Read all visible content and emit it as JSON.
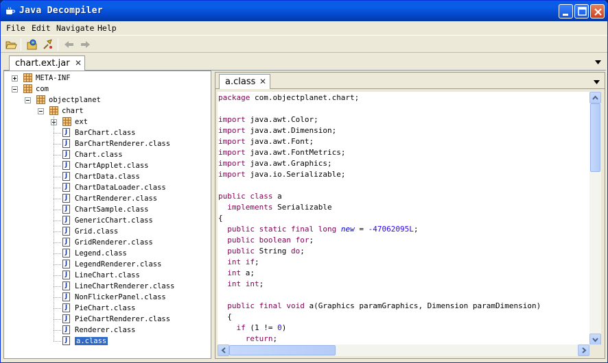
{
  "window": {
    "title": "Java Decompiler"
  },
  "menu": [
    {
      "label": "File"
    },
    {
      "label": "Edit"
    },
    {
      "label": "Navigate"
    },
    {
      "label": "Help"
    }
  ],
  "toolbar": {
    "icons": [
      "open-file-icon",
      "open-type-icon",
      "search-icon",
      "back-arrow-icon",
      "forward-arrow-icon"
    ]
  },
  "left_tab": {
    "label": "chart.ext.jar"
  },
  "right_tab": {
    "label": "a.class"
  },
  "tree": [
    {
      "label": "META-INF",
      "kind": "package",
      "depth": 0,
      "expander": "plus"
    },
    {
      "label": "com",
      "kind": "package",
      "depth": 0,
      "expander": "minus"
    },
    {
      "label": "objectplanet",
      "kind": "package",
      "depth": 1,
      "expander": "minus"
    },
    {
      "label": "chart",
      "kind": "package",
      "depth": 2,
      "expander": "minus"
    },
    {
      "label": "ext",
      "kind": "package",
      "depth": 3,
      "expander": "plus"
    },
    {
      "label": "BarChart.class",
      "kind": "class",
      "depth": 3
    },
    {
      "label": "BarChartRenderer.class",
      "kind": "class",
      "depth": 3
    },
    {
      "label": "Chart.class",
      "kind": "class",
      "depth": 3
    },
    {
      "label": "ChartApplet.class",
      "kind": "class",
      "depth": 3
    },
    {
      "label": "ChartData.class",
      "kind": "class",
      "depth": 3
    },
    {
      "label": "ChartDataLoader.class",
      "kind": "class",
      "depth": 3
    },
    {
      "label": "ChartRenderer.class",
      "kind": "class",
      "depth": 3
    },
    {
      "label": "ChartSample.class",
      "kind": "class",
      "depth": 3
    },
    {
      "label": "GenericChart.class",
      "kind": "class",
      "depth": 3
    },
    {
      "label": "Grid.class",
      "kind": "class",
      "depth": 3
    },
    {
      "label": "GridRenderer.class",
      "kind": "class",
      "depth": 3
    },
    {
      "label": "Legend.class",
      "kind": "class",
      "depth": 3
    },
    {
      "label": "LegendRenderer.class",
      "kind": "class",
      "depth": 3
    },
    {
      "label": "LineChart.class",
      "kind": "class",
      "depth": 3
    },
    {
      "label": "LineChartRenderer.class",
      "kind": "class",
      "depth": 3
    },
    {
      "label": "NonFlickerPanel.class",
      "kind": "class",
      "depth": 3
    },
    {
      "label": "PieChart.class",
      "kind": "class",
      "depth": 3
    },
    {
      "label": "PieChartRenderer.class",
      "kind": "class",
      "depth": 3
    },
    {
      "label": "Renderer.class",
      "kind": "class",
      "depth": 3
    },
    {
      "label": "a.class",
      "kind": "class",
      "depth": 3,
      "selected": true
    }
  ],
  "code": [
    [
      {
        "t": "package",
        "c": "kw"
      },
      {
        "t": " com.objectplanet.chart;"
      }
    ],
    [],
    [
      {
        "t": "import",
        "c": "kw"
      },
      {
        "t": " java.awt.Color;"
      }
    ],
    [
      {
        "t": "import",
        "c": "kw"
      },
      {
        "t": " java.awt.Dimension;"
      }
    ],
    [
      {
        "t": "import",
        "c": "kw"
      },
      {
        "t": " java.awt.Font;"
      }
    ],
    [
      {
        "t": "import",
        "c": "kw"
      },
      {
        "t": " java.awt.FontMetrics;"
      }
    ],
    [
      {
        "t": "import",
        "c": "kw"
      },
      {
        "t": " java.awt.Graphics;"
      }
    ],
    [
      {
        "t": "import",
        "c": "kw"
      },
      {
        "t": " java.io.Serializable;"
      }
    ],
    [],
    [
      {
        "t": "public",
        "c": "kw"
      },
      {
        "t": " "
      },
      {
        "t": "class",
        "c": "kw"
      },
      {
        "t": " a"
      }
    ],
    [
      {
        "t": "  "
      },
      {
        "t": "implements",
        "c": "kw"
      },
      {
        "t": " Serializable"
      }
    ],
    [
      {
        "t": "{"
      }
    ],
    [
      {
        "t": "  "
      },
      {
        "t": "public",
        "c": "kw"
      },
      {
        "t": " "
      },
      {
        "t": "static",
        "c": "kw"
      },
      {
        "t": " "
      },
      {
        "t": "final",
        "c": "kw"
      },
      {
        "t": " "
      },
      {
        "t": "long",
        "c": "kw"
      },
      {
        "t": " "
      },
      {
        "t": "new",
        "c": "fld"
      },
      {
        "t": " = "
      },
      {
        "t": "-47062095L",
        "c": "num"
      },
      {
        "t": ";"
      }
    ],
    [
      {
        "t": "  "
      },
      {
        "t": "public",
        "c": "kw"
      },
      {
        "t": " "
      },
      {
        "t": "boolean",
        "c": "kw"
      },
      {
        "t": " "
      },
      {
        "t": "for",
        "c": "kw"
      },
      {
        "t": ";"
      }
    ],
    [
      {
        "t": "  "
      },
      {
        "t": "public",
        "c": "kw"
      },
      {
        "t": " String "
      },
      {
        "t": "do",
        "c": "kw"
      },
      {
        "t": ";"
      }
    ],
    [
      {
        "t": "  "
      },
      {
        "t": "int",
        "c": "kw"
      },
      {
        "t": " "
      },
      {
        "t": "if",
        "c": "kw"
      },
      {
        "t": ";"
      }
    ],
    [
      {
        "t": "  "
      },
      {
        "t": "int",
        "c": "kw"
      },
      {
        "t": " a;"
      }
    ],
    [
      {
        "t": "  "
      },
      {
        "t": "int",
        "c": "kw"
      },
      {
        "t": " "
      },
      {
        "t": "int",
        "c": "kw"
      },
      {
        "t": ";"
      }
    ],
    [],
    [
      {
        "t": "  "
      },
      {
        "t": "public",
        "c": "kw"
      },
      {
        "t": " "
      },
      {
        "t": "final",
        "c": "kw"
      },
      {
        "t": " "
      },
      {
        "t": "void",
        "c": "kw"
      },
      {
        "t": " a(Graphics paramGraphics, Dimension paramDimension)"
      }
    ],
    [
      {
        "t": "  {"
      }
    ],
    [
      {
        "t": "    "
      },
      {
        "t": "if",
        "c": "kw"
      },
      {
        "t": " (1 != "
      },
      {
        "t": "0",
        "c": "num"
      },
      {
        "t": ")"
      }
    ],
    [
      {
        "t": "      "
      },
      {
        "t": "return",
        "c": "kw"
      },
      {
        "t": ";"
      }
    ]
  ]
}
